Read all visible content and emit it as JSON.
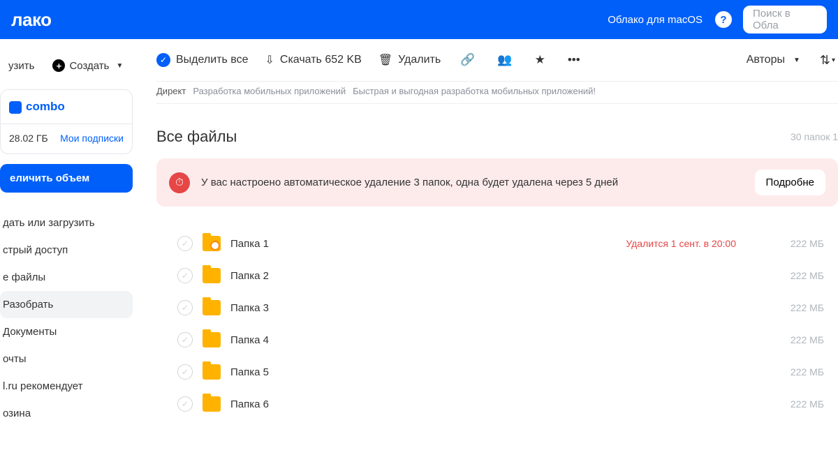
{
  "topbar": {
    "logo": "лако",
    "macos_link": "Облако для macOS",
    "search_placeholder": "Поиск в Обла"
  },
  "sidebar_toolbar": {
    "upload": "узить",
    "create": "Создать"
  },
  "combo": {
    "title": "combo",
    "storage": "28.02 ГБ",
    "subs_link": "Мои подписки"
  },
  "upgrade": "еличить объем",
  "nav": {
    "items": [
      "дать или загрузить",
      "стрый доступ",
      "е файлы",
      "Разобрать",
      "Документы",
      "очты",
      "l.ru рекомендует",
      "озина"
    ],
    "active_index": 3
  },
  "main_toolbar": {
    "select_all": "Выделить все",
    "download": "Скачать 652 KB",
    "delete": "Удалить",
    "authors": "Авторы"
  },
  "ad": {
    "label": "Директ",
    "text1": "Разработка мобильных приложений",
    "text2": "Быстрая и выгодная разработка мобильных приложений!"
  },
  "section": {
    "title": "Все файлы",
    "count": "30 папок 1"
  },
  "alert": {
    "text": "У вас настроено автоматическое удаление 3 папок, одна будет удалена через 5 дней",
    "button": "Подробне"
  },
  "files": [
    {
      "name": "Папка 1",
      "warn": "Удалится 1 сент. в 20:00",
      "size": "222 МБ",
      "scheduled": true
    },
    {
      "name": "Папка 2",
      "warn": "",
      "size": "222 МБ",
      "scheduled": false
    },
    {
      "name": "Папка 3",
      "warn": "",
      "size": "222 МБ",
      "scheduled": false
    },
    {
      "name": "Папка 4",
      "warn": "",
      "size": "222 МБ",
      "scheduled": false
    },
    {
      "name": "Папка 5",
      "warn": "",
      "size": "222 МБ",
      "scheduled": false
    },
    {
      "name": "Папка 6",
      "warn": "",
      "size": "222 МБ",
      "scheduled": false
    }
  ]
}
